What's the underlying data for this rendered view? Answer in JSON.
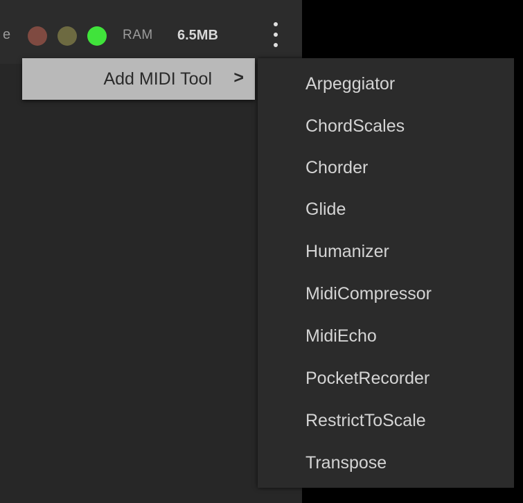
{
  "header": {
    "cut_label": "e",
    "leds": [
      {
        "name": "red",
        "color": "#7f4a41"
      },
      {
        "name": "olive",
        "color": "#6d6a41"
      },
      {
        "name": "green",
        "color": "#40e33b"
      }
    ],
    "ram_label": "RAM",
    "ram_value": "6.5MB",
    "more_icon": "vertical-ellipsis-icon"
  },
  "menu": {
    "parent_label": "Add MIDI Tool",
    "parent_arrow": ">",
    "items": [
      {
        "label": "Arpeggiator"
      },
      {
        "label": "ChordScales"
      },
      {
        "label": "Chorder"
      },
      {
        "label": "Glide"
      },
      {
        "label": "Humanizer"
      },
      {
        "label": "MidiCompressor"
      },
      {
        "label": "MidiEcho"
      },
      {
        "label": "PocketRecorder"
      },
      {
        "label": "RestrictToScale"
      },
      {
        "label": "Transpose"
      }
    ]
  }
}
